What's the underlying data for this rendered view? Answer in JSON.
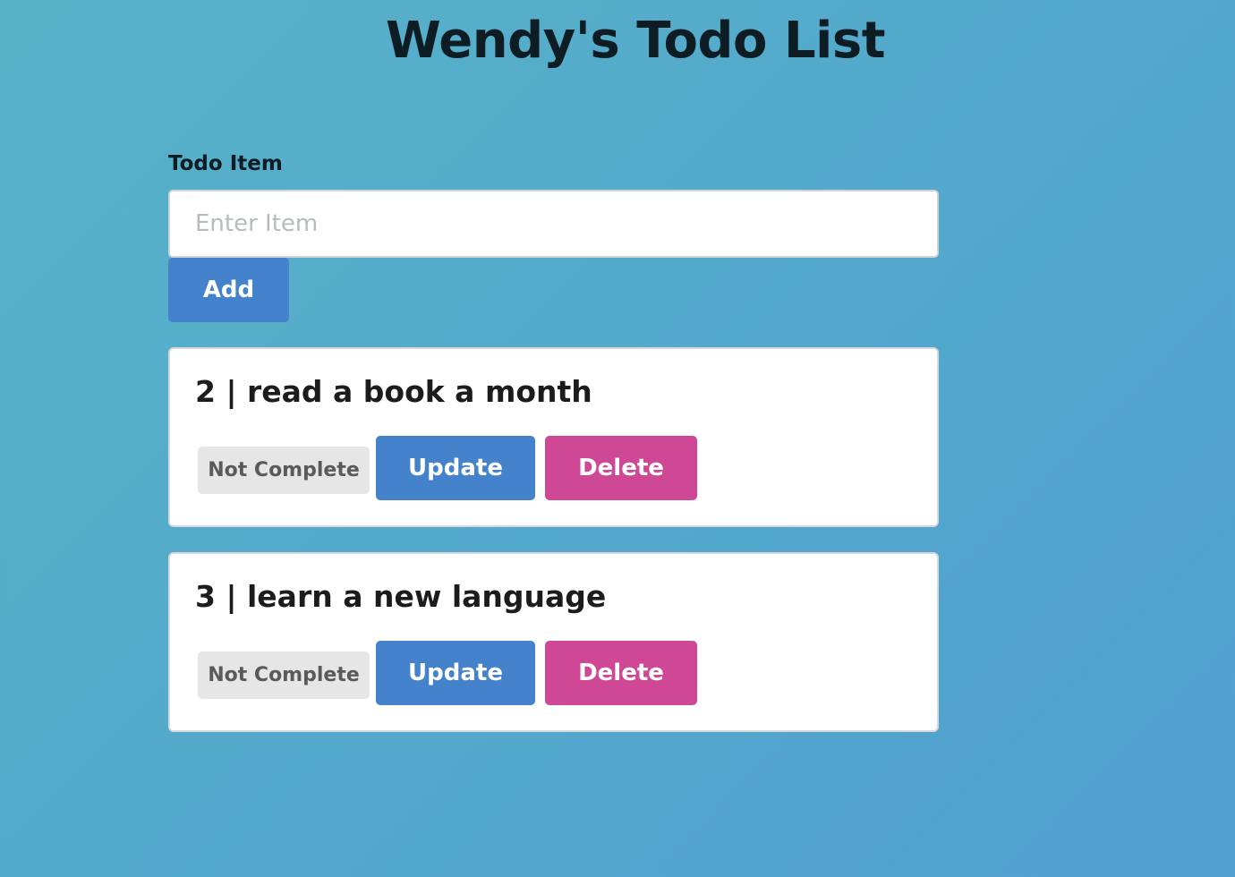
{
  "header": {
    "title": "Wendy's Todo List"
  },
  "form": {
    "label": "Todo Item",
    "input_value": "",
    "input_placeholder": "Enter Item",
    "add_label": "Add"
  },
  "todos": [
    {
      "title": "2 | read a book a month",
      "status": "Not Complete",
      "update_label": "Update",
      "delete_label": "Delete"
    },
    {
      "title": "3 | learn a new language",
      "status": "Not Complete",
      "update_label": "Update",
      "delete_label": "Delete"
    }
  ],
  "colors": {
    "background_start": "#57b2c8",
    "background_end": "#4f9fd0",
    "primary_button": "#4582cc",
    "delete_button": "#cf4896",
    "status_badge": "#e6e6e6",
    "card": "#ffffff",
    "heading_text": "#0e1d24"
  }
}
